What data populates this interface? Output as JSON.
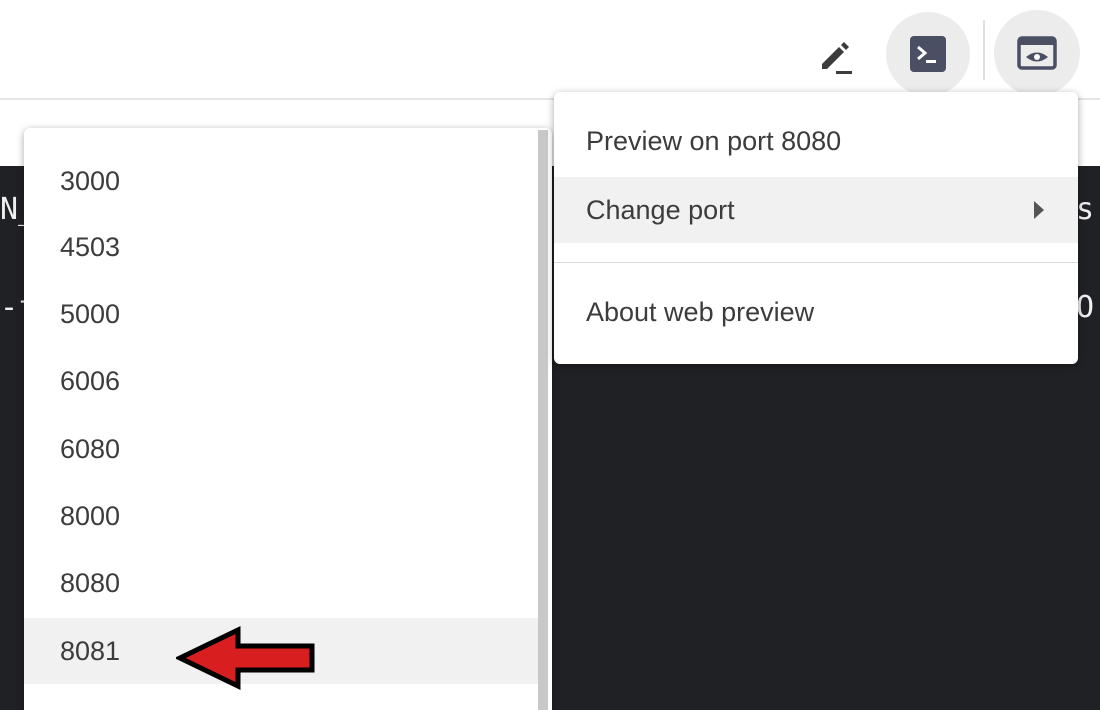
{
  "toolbar": {
    "edit_icon": "pencil-icon",
    "terminal_icon": "terminal-icon",
    "preview_icon": "web-preview-icon"
  },
  "terminal": {
    "fragments": [
      "N_",
      "-f",
      "s",
      "O"
    ]
  },
  "port_menu": {
    "items": [
      "3000",
      "4503",
      "5000",
      "6006",
      "6080",
      "8000",
      "8080",
      "8081"
    ],
    "highlighted": "8081"
  },
  "preview_menu": {
    "preview_label": "Preview on port 8080",
    "change_port_label": "Change port",
    "about_label": "About web preview"
  },
  "colors": {
    "terminal_bg": "#202124",
    "icon_bg": "#ececec",
    "icon_fg": "#4a4f63",
    "annotation_arrow": "#d81e1e"
  }
}
